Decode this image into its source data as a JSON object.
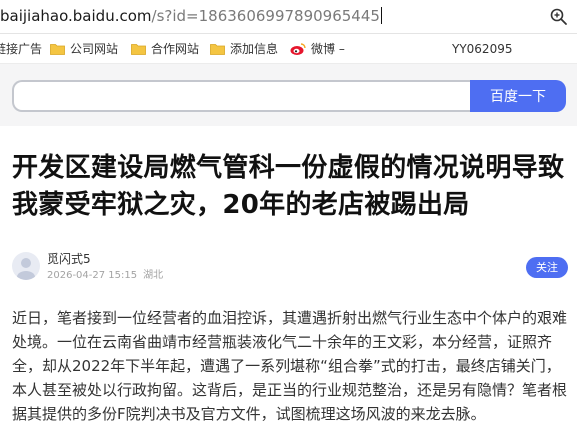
{
  "address_bar": {
    "host": "baijiahao.baidu.com",
    "path": "/s?id=1863606997890965445"
  },
  "icons": {
    "zoom": "zoom-magnifier-icon",
    "folder": "folder-icon",
    "weibo": "weibo-icon",
    "avatar": "user-avatar-icon"
  },
  "bookmarks": {
    "items": [
      {
        "label": "链接广告"
      },
      {
        "label": "公司网站"
      },
      {
        "label": "合作网站"
      },
      {
        "label": "添加信息"
      },
      {
        "label": "微博 –"
      }
    ],
    "right_text": "YY062095"
  },
  "search": {
    "placeholder": "",
    "button_label": "百度一下"
  },
  "article": {
    "title": "开发区建设局燃气管科一份虚假的情况说明导致我蒙受牢狱之灾，20年的老店被踢出局",
    "author": "觅闪式5",
    "date": "2026-04-27 15:15",
    "location": "湖北",
    "follow_label": "关注",
    "paragraph": "近日，笔者接到一位经营者的血泪控诉，其遭遇折射出燃气行业生态中个体户的艰难处境。一位在云南省曲靖市经营瓶装液化气二十余年的王文彩，本分经营，证照齐全，却从2022年下半年起，遭遇了一系列堪称“组合拳”式的打击，最终店铺关门，本人甚至被处以行政拘留。这背后，是正当的行业规范整治，还是另有隐情？笔者根据其提供的多份F院判决书及官方文件，试图梳理这场风波的来龙去脉。"
  },
  "colors": {
    "accent": "#4e6ef2",
    "folder": "#f4c542",
    "weibo": "#e6162d"
  }
}
